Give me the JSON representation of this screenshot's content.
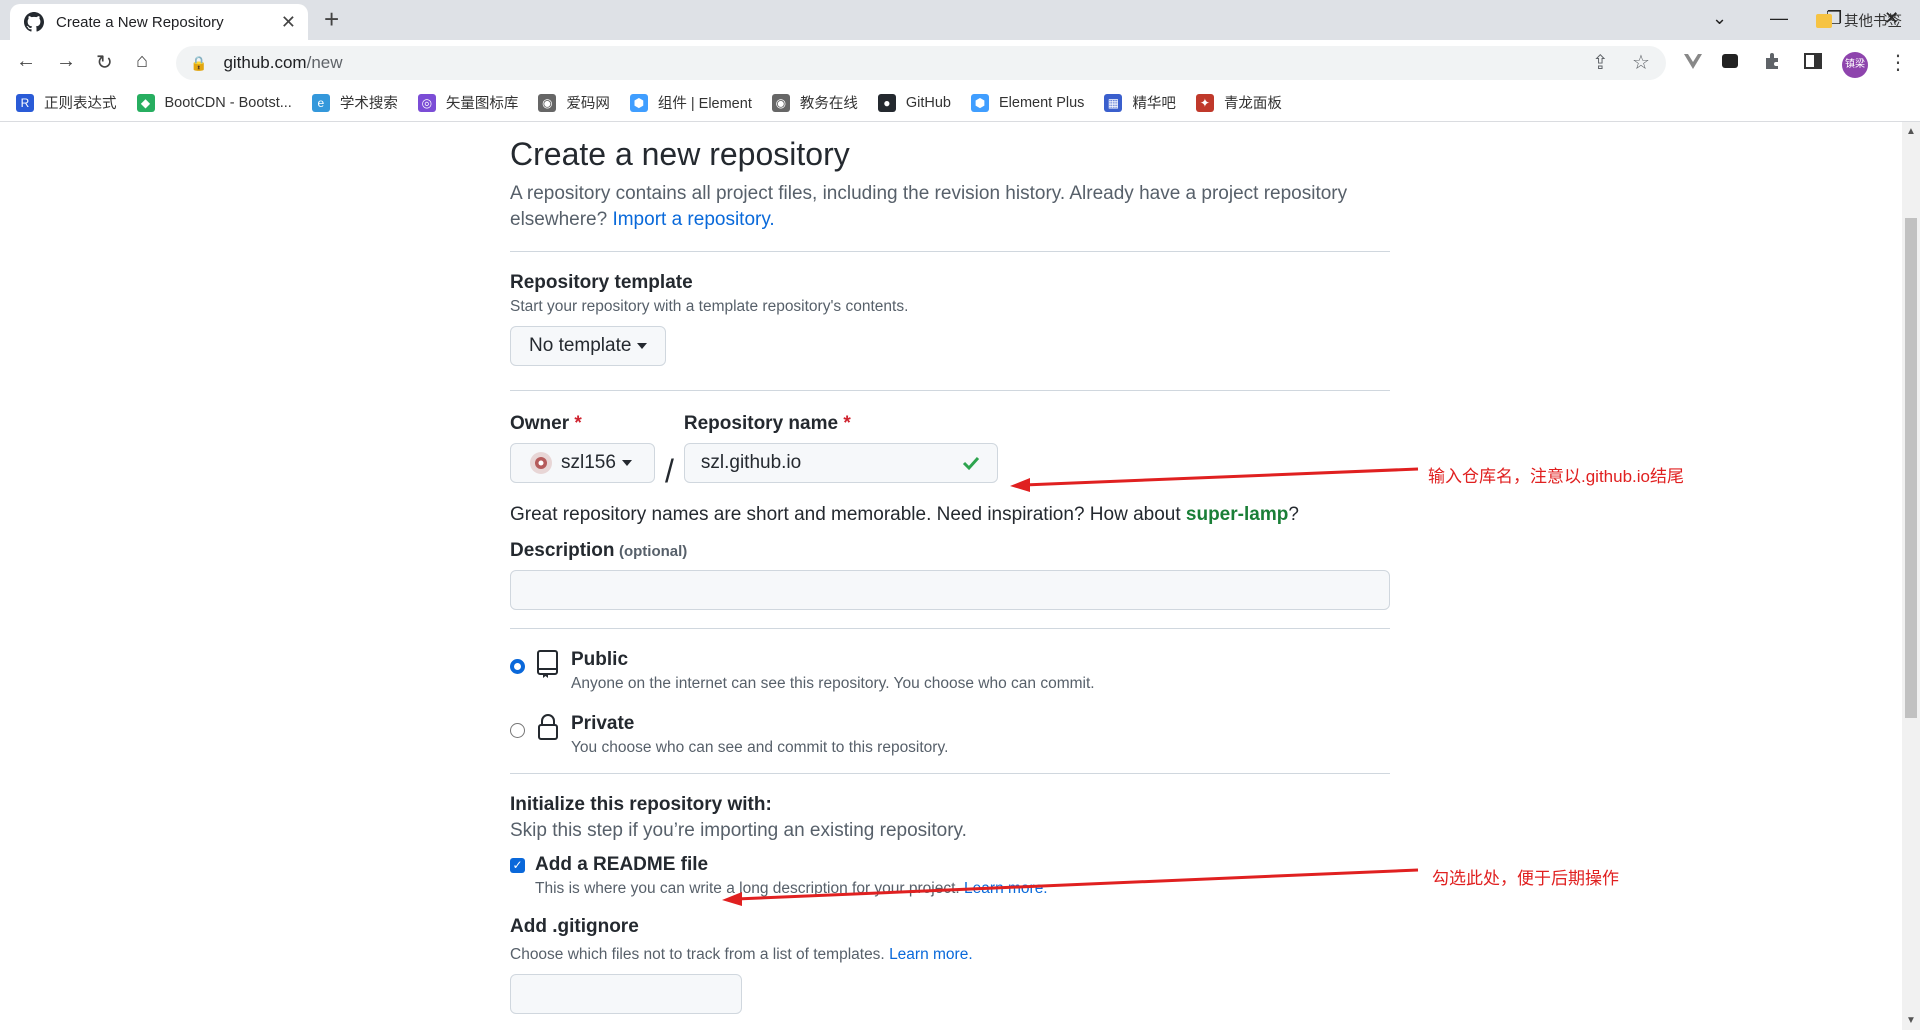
{
  "browser": {
    "tab_title": "Create a New Repository",
    "tab_close": "✕",
    "new_tab": "+",
    "url_host": "github.com",
    "url_path": "/new",
    "profile_initials": "镇梁",
    "extension_badge": "2",
    "window_controls": {
      "dropdown": "⌄",
      "minimize": "—",
      "restore": "❐",
      "close": "✕"
    }
  },
  "bookmarks": [
    {
      "label": "正则表达式",
      "icon": "R",
      "color": "#2a5bd7"
    },
    {
      "label": "BootCDN - Bootst...",
      "icon": "◆",
      "color": "#27ae60"
    },
    {
      "label": "学术搜索",
      "icon": "e",
      "color": "#3498db"
    },
    {
      "label": "矢量图标库",
      "icon": "◎",
      "color": "#7b4dd6"
    },
    {
      "label": "爱码网",
      "icon": "◉",
      "color": "#666666"
    },
    {
      "label": "组件 | Element",
      "icon": "⬢",
      "color": "#409eff"
    },
    {
      "label": "教务在线",
      "icon": "◉",
      "color": "#666666"
    },
    {
      "label": "GitHub",
      "icon": "●",
      "color": "#24292f"
    },
    {
      "label": "Element Plus",
      "icon": "⬢",
      "color": "#409eff"
    },
    {
      "label": "精华吧",
      "icon": "▦",
      "color": "#3a5fcd"
    },
    {
      "label": "青龙面板",
      "icon": "✦",
      "color": "#c0392b"
    }
  ],
  "other_bookmarks": "其他书签",
  "page": {
    "title": "Create a new repository",
    "subtitle_text": "A repository contains all project files, including the revision history. Already have a project repository elsewhere?",
    "import_link": "Import a repository.",
    "template": {
      "label": "Repository template",
      "note": "Start your repository with a template repository's contents.",
      "value": "No template"
    },
    "owner": {
      "label": "Owner",
      "required_mark": "*",
      "value": "szl156"
    },
    "slash": "/",
    "repo_name": {
      "label": "Repository name",
      "required_mark": "*",
      "value": "szl.github.io"
    },
    "suggestion_prefix": "Great repository names are short and memorable. Need inspiration? How about",
    "suggestion_name": "super-lamp",
    "suggestion_suffix": "?",
    "description": {
      "label": "Description",
      "optional": "(optional)",
      "value": ""
    },
    "visibility": {
      "public": {
        "label": "Public",
        "note": "Anyone on the internet can see this repository. You choose who can commit.",
        "selected": true
      },
      "private": {
        "label": "Private",
        "note": "You choose who can see and commit to this repository.",
        "selected": false
      }
    },
    "init": {
      "label": "Initialize this repository with:",
      "note": "Skip this step if you’re importing an existing repository.",
      "readme": {
        "label": "Add a README file",
        "note": "This is where you can write a long description for your project.",
        "learn": "Learn more.",
        "checked": true
      }
    },
    "gitignore": {
      "label": "Add .gitignore",
      "note": "Choose which files not to track from a list of templates.",
      "learn": "Learn more."
    }
  },
  "annotations": {
    "repo_name_hint": "输入仓库名，注意以.github.io结尾",
    "readme_hint": "勾选此处，便于后期操作"
  },
  "colors": {
    "link": "#0969da",
    "annotation": "#e02020",
    "success": "#2da44e",
    "accent": "#0a68da"
  }
}
